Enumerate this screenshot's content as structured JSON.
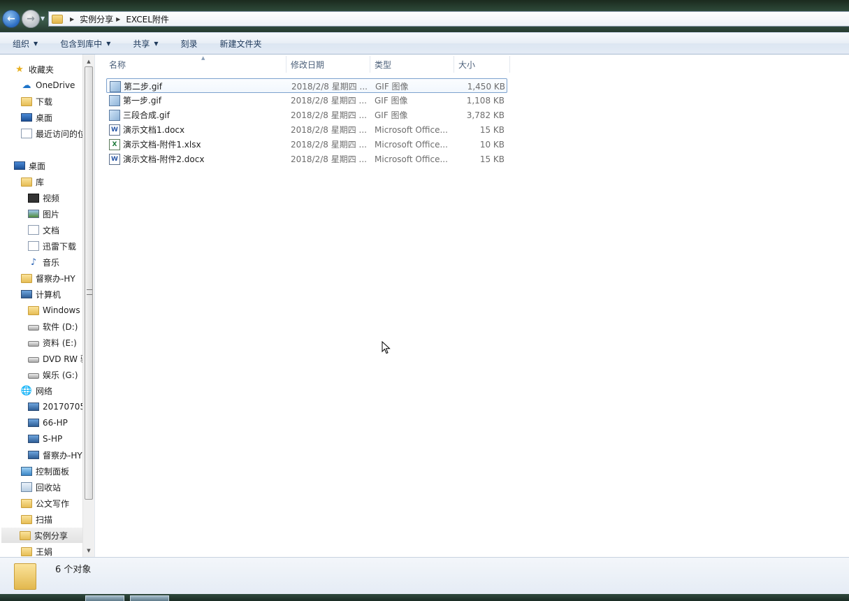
{
  "address": {
    "crumbs": [
      "实例分享",
      "EXCEL附件"
    ]
  },
  "toolbar": {
    "organize": "组织",
    "include_in_library": "包含到库中",
    "share": "共享",
    "burn": "刻录",
    "new_folder": "新建文件夹"
  },
  "nav": {
    "favorites": "收藏夹",
    "onedrive": "OneDrive",
    "downloads": "下载",
    "desktop_fav": "桌面",
    "recent": "最近访问的位",
    "desktop": "桌面",
    "libraries": "库",
    "videos": "视频",
    "pictures": "图片",
    "documents": "文档",
    "xunlei": "迅雷下载",
    "music": "音乐",
    "user_dudu": "督察办-HY",
    "computer": "计算机",
    "windows": "Windows",
    "drive_d": "软件 (D:)",
    "drive_e": "资料 (E:)",
    "dvd": "DVD RW 驱",
    "drive_g": "娱乐 (G:)",
    "network": "网络",
    "net_20170705": "20170705",
    "net_66hp": "66-HP",
    "net_shp": "S-HP",
    "net_dudu": "督察办-HY",
    "control_panel": "控制面板",
    "recycle_bin": "回收站",
    "gongwen": "公文写作",
    "scan": "扫描",
    "shili": "实例分享",
    "wangjuan": "王娟"
  },
  "columns": {
    "name": "名称",
    "date": "修改日期",
    "type": "类型",
    "size": "大小"
  },
  "files": [
    {
      "name": "第二步.gif",
      "date": "2018/2/8 星期四 ...",
      "type": "GIF 图像",
      "size": "1,450 KB",
      "kind": "gif"
    },
    {
      "name": "第一步.gif",
      "date": "2018/2/8 星期四 ...",
      "type": "GIF 图像",
      "size": "1,108 KB",
      "kind": "gif"
    },
    {
      "name": "三段合成.gif",
      "date": "2018/2/8 星期四 ...",
      "type": "GIF 图像",
      "size": "3,782 KB",
      "kind": "gif"
    },
    {
      "name": "演示文档1.docx",
      "date": "2018/2/8 星期四 ...",
      "type": "Microsoft Office...",
      "size": "15 KB",
      "kind": "word"
    },
    {
      "name": "演示文档-附件1.xlsx",
      "date": "2018/2/8 星期四 ...",
      "type": "Microsoft Office...",
      "size": "10 KB",
      "kind": "excel"
    },
    {
      "name": "演示文档-附件2.docx",
      "date": "2018/2/8 星期四 ...",
      "type": "Microsoft Office...",
      "size": "15 KB",
      "kind": "word"
    }
  ],
  "status": {
    "count": "6 个对象"
  }
}
